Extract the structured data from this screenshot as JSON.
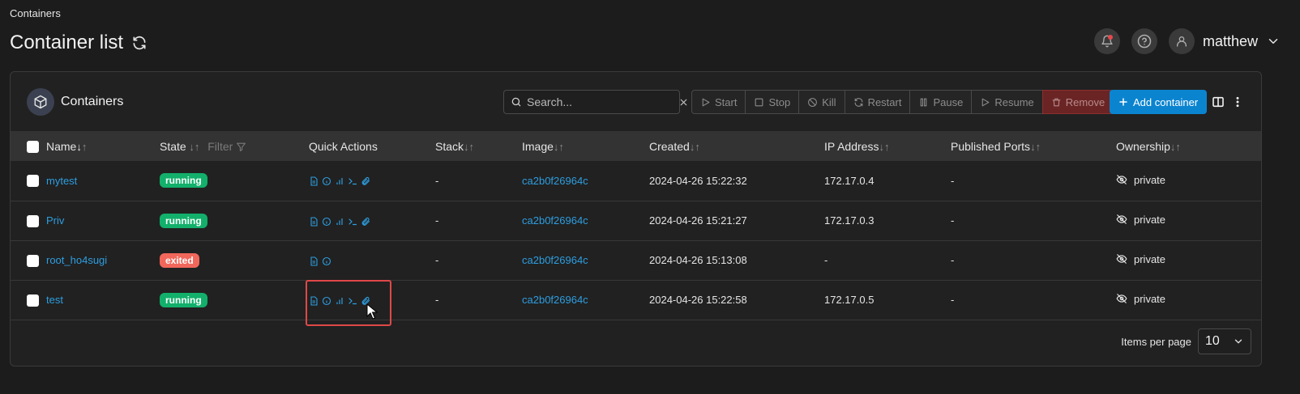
{
  "breadcrumb": "Containers",
  "page_title": "Container list",
  "user": {
    "name": "matthew"
  },
  "panel": {
    "title": "Containers",
    "search_placeholder": "Search...",
    "actions": [
      {
        "label": "Start",
        "icon": "play-icon"
      },
      {
        "label": "Stop",
        "icon": "stop-icon"
      },
      {
        "label": "Kill",
        "icon": "ban-icon"
      },
      {
        "label": "Restart",
        "icon": "restart-icon"
      },
      {
        "label": "Pause",
        "icon": "pause-icon"
      },
      {
        "label": "Resume",
        "icon": "play-icon"
      },
      {
        "label": "Remove",
        "icon": "trash-icon"
      }
    ],
    "add_label": "Add container"
  },
  "table": {
    "headers": {
      "name": "Name",
      "state": "State",
      "filter": "Filter",
      "quick_actions": "Quick Actions",
      "stack": "Stack",
      "image": "Image",
      "created": "Created",
      "ip": "IP Address",
      "ports": "Published Ports",
      "ownership": "Ownership"
    },
    "rows": [
      {
        "name": "mytest",
        "state": "running",
        "stack": "-",
        "image": "ca2b0f26964c",
        "created": "2024-04-26 15:22:32",
        "ip": "172.17.0.4",
        "ports": "-",
        "ownership": "private"
      },
      {
        "name": "Priv",
        "state": "running",
        "stack": "-",
        "image": "ca2b0f26964c",
        "created": "2024-04-26 15:21:27",
        "ip": "172.17.0.3",
        "ports": "-",
        "ownership": "private"
      },
      {
        "name": "root_ho4sugi",
        "state": "exited",
        "stack": "-",
        "image": "ca2b0f26964c",
        "created": "2024-04-26 15:13:08",
        "ip": "-",
        "ports": "-",
        "ownership": "private"
      },
      {
        "name": "test",
        "state": "running",
        "stack": "-",
        "image": "ca2b0f26964c",
        "created": "2024-04-26 15:22:58",
        "ip": "172.17.0.5",
        "ports": "-",
        "ownership": "private"
      }
    ]
  },
  "footer": {
    "items_per_page_label": "Items per page",
    "items_per_page": "10"
  },
  "colors": {
    "accent": "#0b84d0",
    "link": "#2d9ee0",
    "running": "#12b06b",
    "exited": "#f2675b",
    "remove": "#6b2424",
    "highlight": "#e04848"
  }
}
